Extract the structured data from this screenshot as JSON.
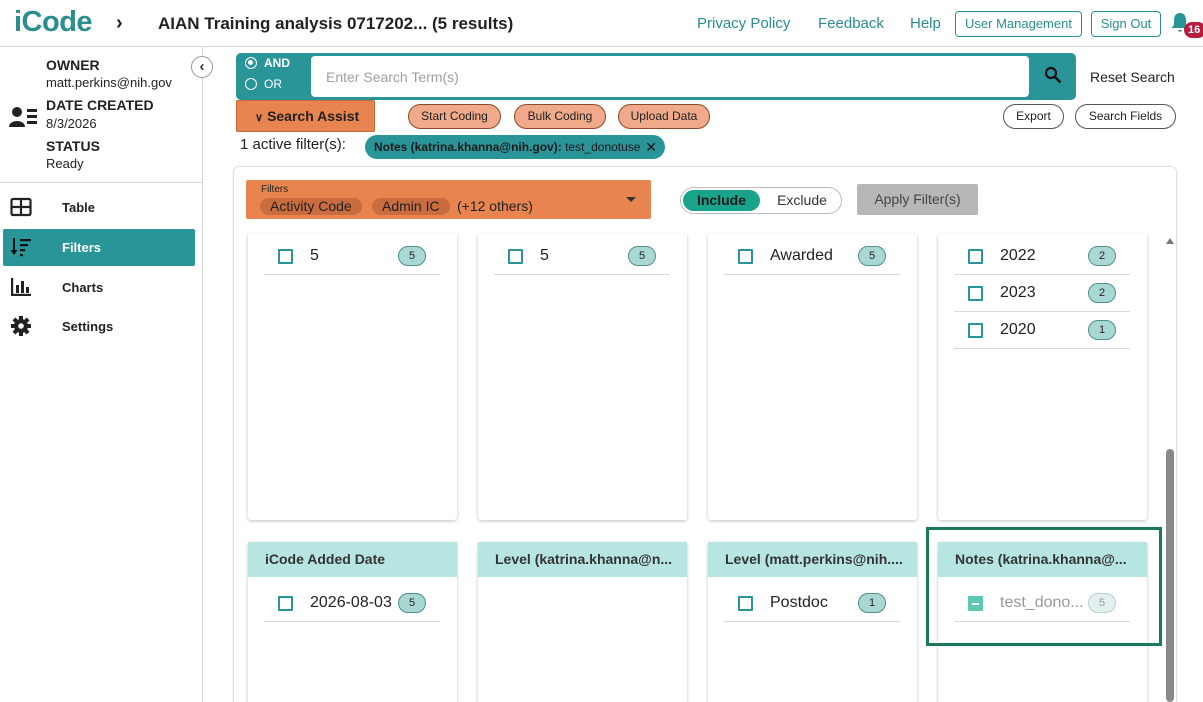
{
  "header": {
    "logo": "iCode",
    "page_title": "AIAN Training analysis 0717202... (5 results)",
    "links": {
      "privacy": "Privacy Policy",
      "feedback": "Feedback",
      "help": "Help"
    },
    "buttons": {
      "user_management": "User Management",
      "sign_out": "Sign Out"
    },
    "notification_count": "16"
  },
  "sidebar": {
    "owner_label": "OWNER",
    "owner_value": "matt.perkins@nih.gov",
    "date_label": "DATE CREATED",
    "date_value": "8/3/2026",
    "status_label": "STATUS",
    "status_value": "Ready",
    "nav": [
      {
        "label": "Table",
        "icon": "table-icon"
      },
      {
        "label": "Filters",
        "icon": "filter-sort-icon",
        "active": true
      },
      {
        "label": "Charts",
        "icon": "bar-chart-icon"
      },
      {
        "label": "Settings",
        "icon": "gear-icon"
      }
    ]
  },
  "search": {
    "and_label": "AND",
    "or_label": "OR",
    "mode": "AND",
    "placeholder": "Enter Search Term(s)",
    "value": "",
    "reset_label": "Reset Search"
  },
  "actions": {
    "search_assist": "Search Assist",
    "start_coding": "Start Coding",
    "bulk_coding": "Bulk Coding",
    "upload_data": "Upload Data",
    "export": "Export",
    "search_fields": "Search Fields"
  },
  "active_filters": {
    "text": "1 active filter(s):",
    "chip_field": "Notes (katrina.khanna@nih.gov):",
    "chip_value": "test_donotuse"
  },
  "filter_panel": {
    "select_label": "Filters",
    "selected_tags": [
      "Activity Code",
      "Admin IC"
    ],
    "more_text": "(+12 others)",
    "include_label": "Include",
    "exclude_label": "Exclude",
    "toggle_state": "Include",
    "apply_label": "Apply Filter(s)"
  },
  "cards_top": [
    {
      "rows": [
        {
          "label": "5",
          "count": "5"
        }
      ]
    },
    {
      "rows": [
        {
          "label": "5",
          "count": "5"
        }
      ]
    },
    {
      "rows": [
        {
          "label": "Awarded",
          "count": "5"
        }
      ]
    },
    {
      "rows": [
        {
          "label": "2022",
          "count": "2"
        },
        {
          "label": "2023",
          "count": "2"
        },
        {
          "label": "2020",
          "count": "1"
        }
      ]
    }
  ],
  "cards_bottom": [
    {
      "title": "iCode Added Date",
      "rows": [
        {
          "label": "2026-08-03",
          "count": "5"
        }
      ]
    },
    {
      "title": "Level (katrina.khanna@n...",
      "rows": []
    },
    {
      "title": "Level (matt.perkins@nih....",
      "rows": [
        {
          "label": "Postdoc",
          "count": "1"
        }
      ]
    },
    {
      "title": "Notes (katrina.khanna@...",
      "rows": [
        {
          "label": "test_dono...",
          "count": "5",
          "state": "partial"
        }
      ]
    }
  ],
  "colors": {
    "teal": "#2a9598",
    "orange": "#e8844f",
    "card_header": "#b7e5e2",
    "include_green": "#1aa38b",
    "highlight": "#1a7a56"
  }
}
